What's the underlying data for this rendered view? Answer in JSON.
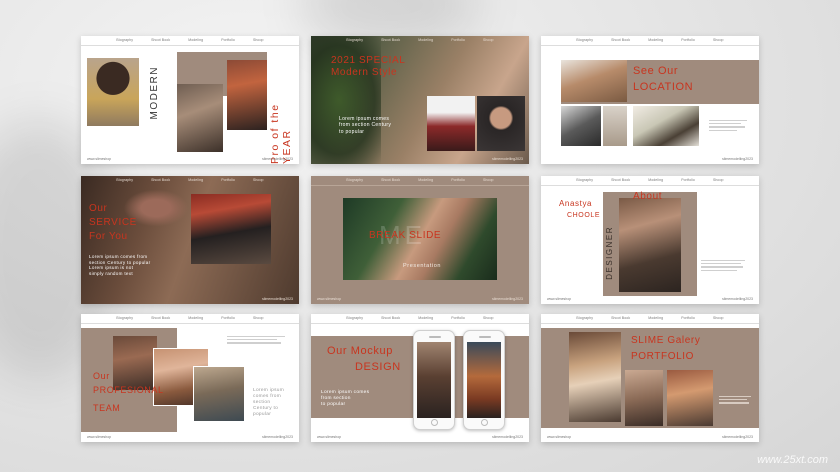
{
  "nav": [
    "Biography",
    "Shoot Book",
    "Modeling",
    "Portfolio",
    "Shoop"
  ],
  "footer": {
    "left": "www.slimeshop",
    "right": "slimemodelling2023"
  },
  "slide1": {
    "title_vertical_dark": "MODERN",
    "title_vertical_red": "Pro of the YEAR"
  },
  "slide2": {
    "title_line1": "2021 SPECIAL",
    "title_line2": "Modern Style",
    "para": [
      "Lorem ipsum comes",
      "from section Century",
      "to popular"
    ]
  },
  "slide3": {
    "title_line1": "See Our",
    "title_line2": "LOCATION"
  },
  "slide4": {
    "title_line1": "Our",
    "title_line2": "SERVICE",
    "title_line3": "For You",
    "para": [
      "Lorem ipsum comes from",
      "section Century to popular",
      "Lorem ipsum is not",
      "simply random text"
    ]
  },
  "slide5": {
    "title": "BREAK SLIDE",
    "big_letters": "ME",
    "subtitle": "Presentation"
  },
  "slide6": {
    "name_line1": "Anastya",
    "name_line2": "CHOOLE",
    "about": "About",
    "vertical": "DESIGNER"
  },
  "slide7": {
    "title_line1": "Our",
    "title_line2": "PROFESIONAL",
    "title_line3": "TEAM",
    "para": [
      "Lorem ipsum",
      "comes from",
      "section",
      "Century to",
      "popular"
    ]
  },
  "slide8": {
    "title_line1": "Our Mockup",
    "title_line2": "DESIGN",
    "para": [
      "Lorem ipsum comes",
      "from section",
      "to popular"
    ]
  },
  "slide9": {
    "title_line1": "SLIME Galery",
    "title_line2": "PORTFOLIO"
  },
  "watermark": "www.25xt.com",
  "colors": {
    "taupe": "#a08b7d",
    "accent_red": "#c8351f",
    "background": "#e2e2e2"
  }
}
